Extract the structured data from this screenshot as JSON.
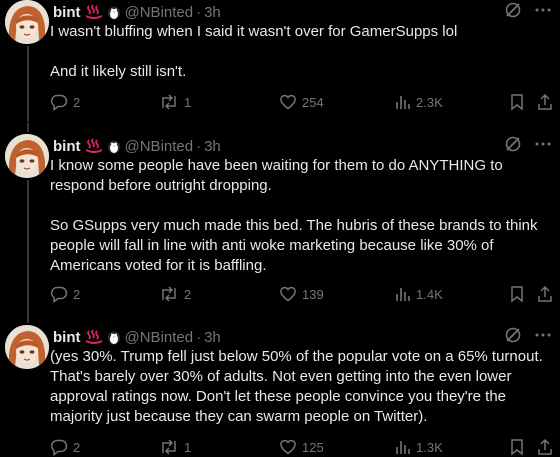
{
  "colors": {
    "background": "#000000",
    "text": "#e7e9ea",
    "muted": "#71767b",
    "thread_line": "#333639",
    "emoji_red": "#e0245e"
  },
  "tweets": [
    {
      "display_name": "bint",
      "handle": "@NBinted",
      "separator": "·",
      "time": "3h",
      "paragraphs": [
        "I wasn't bluffing when I said it wasn't over for GamerSupps lol",
        "And it likely still isn't."
      ],
      "replies": "2",
      "reposts": "1",
      "likes": "254",
      "views": "2.3K"
    },
    {
      "display_name": "bint",
      "handle": "@NBinted",
      "separator": "·",
      "time": "3h",
      "paragraphs": [
        "I know some people have been waiting for them to do ANYTHING to respond before outright dropping.",
        "So GSupps very much made this bed. The hubris of these brands to think people will fall in line with anti woke marketing because like 30% of Americans voted for it is baffling."
      ],
      "replies": "2",
      "reposts": "2",
      "likes": "139",
      "views": "1.4K"
    },
    {
      "display_name": "bint",
      "handle": "@NBinted",
      "separator": "·",
      "time": "3h",
      "paragraphs": [
        "(yes 30%. Trump fell just below 50% of the popular vote on a 65% turnout. That's barely over 30% of adults. Not even getting into the even lower approval ratings now. Don't let these people convince you they're the majority just because they can swarm people on Twitter)."
      ],
      "replies": "2",
      "reposts": "1",
      "likes": "125",
      "views": "1.3K"
    }
  ],
  "icons": {
    "emoji_1": "hot-springs-icon",
    "emoji_2": "penguin-icon",
    "grok": "grok-icon",
    "more": "more-icon",
    "reply": "reply-icon",
    "repost": "repost-icon",
    "like": "like-icon",
    "views": "views-icon",
    "bookmark": "bookmark-icon",
    "share": "share-icon"
  }
}
